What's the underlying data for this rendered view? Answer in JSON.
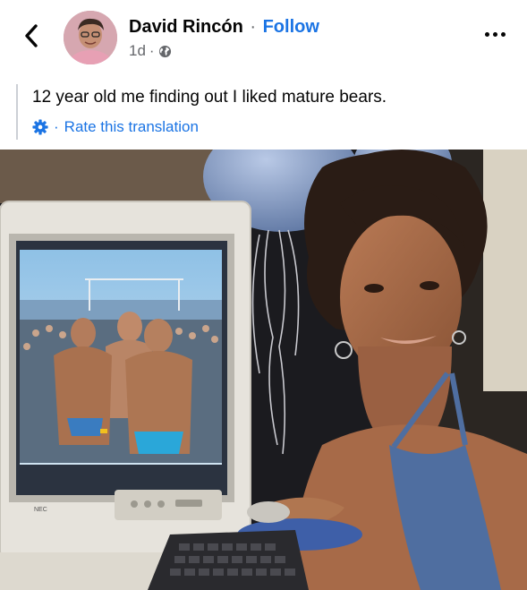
{
  "post": {
    "author_name": "David Rincón",
    "separator": "·",
    "follow_label": "Follow",
    "time_ago": "1d",
    "time_separator": "·",
    "visibility_icon": "globe-icon",
    "caption": "12 year old me finding out I liked mature bears.",
    "rate_separator": "·",
    "rate_translation_label": "Rate this translation",
    "rate_icon": "gear-icon"
  },
  "header": {
    "back_icon": "chevron-left-icon",
    "more_icon": "more-options-icon"
  },
  "photo": {
    "monitor_brand": "NEC"
  },
  "colors": {
    "link": "#1b74e4",
    "secondary_text": "#65676b",
    "primary_text": "#050505"
  }
}
